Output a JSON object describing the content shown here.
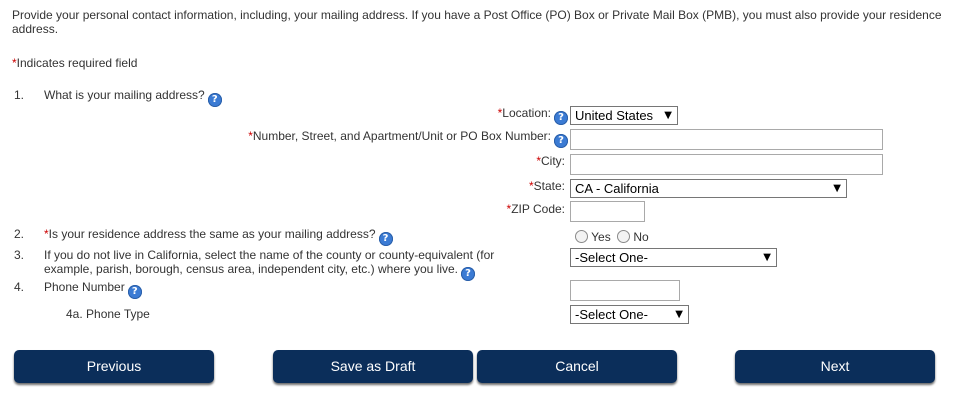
{
  "intro": {
    "text": "Provide your personal contact information, including, your mailing address. If you have a Post Office (PO) Box or Private Mail Box (PMB), you must also provide your residence address."
  },
  "required_note": {
    "mark": "*",
    "text": "Indicates required field"
  },
  "questions": {
    "q1": {
      "num": "1.",
      "label": "What is your mailing address?"
    },
    "q2": {
      "num": "2.",
      "mark": "*",
      "label": "Is your residence address the same as your mailing address?"
    },
    "q3": {
      "num": "3.",
      "label_line1": "If you do not live in California, select the name of the county or county-equivalent (for",
      "label_line2": "example, parish, borough, census area, independent city, etc.) where you live."
    },
    "q4": {
      "num": "4.",
      "label": "Phone Number"
    },
    "q4a": {
      "label": "4a. Phone Type"
    }
  },
  "fields": {
    "location": {
      "mark": "*",
      "label": "Location:",
      "value": "United States"
    },
    "street": {
      "mark": "*",
      "label": "Number, Street, and Apartment/Unit or PO Box Number:",
      "value": ""
    },
    "city": {
      "mark": "*",
      "label": "City:",
      "value": ""
    },
    "state": {
      "mark": "*",
      "label": "State:",
      "value": "CA - California"
    },
    "zip": {
      "mark": "*",
      "label": "ZIP Code:",
      "value": ""
    },
    "residence_same": {
      "yes_label": "Yes",
      "no_label": "No"
    },
    "county": {
      "value": "-Select One-"
    },
    "phone": {
      "value": ""
    },
    "phone_type": {
      "value": "-Select One-"
    }
  },
  "help_glyph": "?",
  "dropdown_glyph": "▼",
  "buttons": {
    "previous": "Previous",
    "save_draft": "Save as Draft",
    "cancel": "Cancel",
    "next": "Next"
  },
  "colors": {
    "button_bg": "#0b2e5a",
    "required": "#cc0000",
    "help_icon": "#3b7bd4"
  }
}
